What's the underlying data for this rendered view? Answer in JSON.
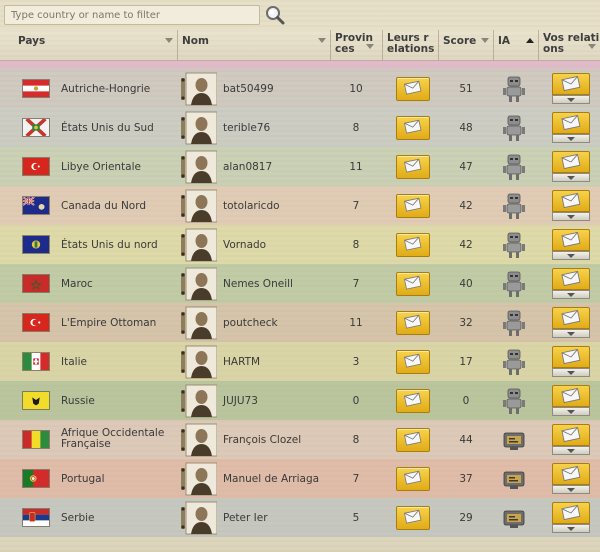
{
  "filter": {
    "placeholder": "Type country or name to filter"
  },
  "columns": {
    "pays": "Pays",
    "nom": "Nom",
    "provinces_1": "Provin",
    "provinces_2": "ces",
    "leurs_1": "Leurs r",
    "leurs_2": "elations",
    "score": "Score",
    "ia": "IA",
    "vos_1": "Vos relati",
    "vos_2": "ons"
  },
  "rows": [
    {
      "country": "Autriche-Hongrie",
      "country_line2": "",
      "player": "bat50499",
      "provinces": "10",
      "score": "51",
      "ia": "robot-icon",
      "tint": "rgba(150,150,175,0.28)",
      "flag": "austria"
    },
    {
      "country": "États Unis du Sud",
      "country_line2": "",
      "player": "terible76",
      "provinces": "8",
      "score": "48",
      "ia": "robot-icon",
      "tint": "rgba(140,160,190,0.28)",
      "flag": "csa"
    },
    {
      "country": "Libye Orientale",
      "country_line2": "",
      "player": "alan0817",
      "provinces": "11",
      "score": "47",
      "ia": "robot-icon",
      "tint": "rgba(150,185,150,0.32)",
      "flag": "libya"
    },
    {
      "country": "Canada du Nord",
      "country_line2": "",
      "player": "totolaricdo",
      "provinces": "7",
      "score": "42",
      "ia": "robot-icon",
      "tint": "rgba(220,170,150,0.30)",
      "flag": "canada"
    },
    {
      "country": "États Unis du nord",
      "country_line2": "",
      "player": "Vornado",
      "provinces": "8",
      "score": "42",
      "ia": "robot-icon",
      "tint": "rgba(215,215,120,0.34)",
      "flag": "usa_north"
    },
    {
      "country": "Maroc",
      "country_line2": "",
      "player": "Nemes Oneill",
      "provinces": "7",
      "score": "40",
      "ia": "robot-icon",
      "tint": "rgba(130,175,110,0.34)",
      "flag": "morocco"
    },
    {
      "country": "L'Empire Ottoman",
      "country_line2": "",
      "player": "poutcheck",
      "provinces": "11",
      "score": "32",
      "ia": "robot-icon",
      "tint": "rgba(185,150,120,0.30)",
      "flag": "ottoman"
    },
    {
      "country": "Italie",
      "country_line2": "",
      "player": "HARTM",
      "provinces": "3",
      "score": "17",
      "ia": "robot-icon",
      "tint": "rgba(205,205,120,0.34)",
      "flag": "italy"
    },
    {
      "country": "Russie",
      "country_line2": "",
      "player": "JUJU73",
      "provinces": "0",
      "score": "0",
      "ia": "robot-icon",
      "tint": "rgba(130,170,110,0.40)",
      "flag": "russia"
    },
    {
      "country": "Afrique Occidentale",
      "country_line2": "Française",
      "player": "François Clozel",
      "provinces": "8",
      "score": "44",
      "ia": "computer-icon",
      "tint": "rgba(215,170,170,0.32)",
      "flag": "guinea"
    },
    {
      "country": "Portugal",
      "country_line2": "",
      "player": "Manuel de Arriaga",
      "provinces": "7",
      "score": "37",
      "ia": "computer-icon",
      "tint": "rgba(225,150,140,0.40)",
      "flag": "portugal"
    },
    {
      "country": "Serbie",
      "country_line2": "",
      "player": "Peter Ier",
      "provinces": "5",
      "score": "29",
      "ia": "computer-icon",
      "tint": "rgba(150,170,200,0.32)",
      "flag": "serbia"
    }
  ]
}
